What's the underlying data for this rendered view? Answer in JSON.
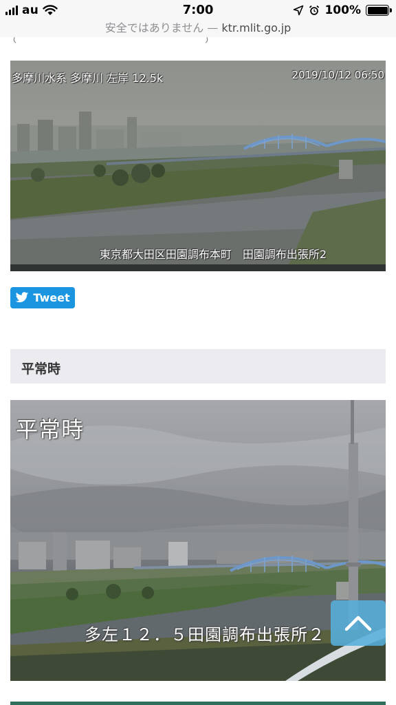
{
  "status_bar": {
    "carrier": "au",
    "time": "7:00",
    "battery_percent": "100%",
    "battery_level": 1.0,
    "icons": [
      "signal-icon",
      "wifi-icon",
      "location-arrow-icon",
      "alarm-icon",
      "battery-icon"
    ]
  },
  "url_bar": {
    "security_text": "安全ではありません",
    "separator": " — ",
    "host": "ktr.mlit.go.jp"
  },
  "camera_live": {
    "caption_top": "多摩川水系 多摩川 左岸 12.5k",
    "timestamp": "2019/10/12 06:50",
    "caption_bottom": "東京都大田区田園調布本町　田園調布出張所2"
  },
  "tweet_button": {
    "label": "Tweet",
    "icon": "twitter-bird-icon",
    "color": "#1b95e0"
  },
  "normal_section": {
    "title": "平常時"
  },
  "camera_normal": {
    "overlay_title": "平常時",
    "caption_bottom": "多左１２．５田園調布出張所２"
  },
  "back_to_top": {
    "icon": "chevron-up-icon",
    "color": "#56aedc"
  },
  "colors": {
    "section_header_bg": "#ebebf0",
    "footer_accent": "#2f6f5c"
  }
}
